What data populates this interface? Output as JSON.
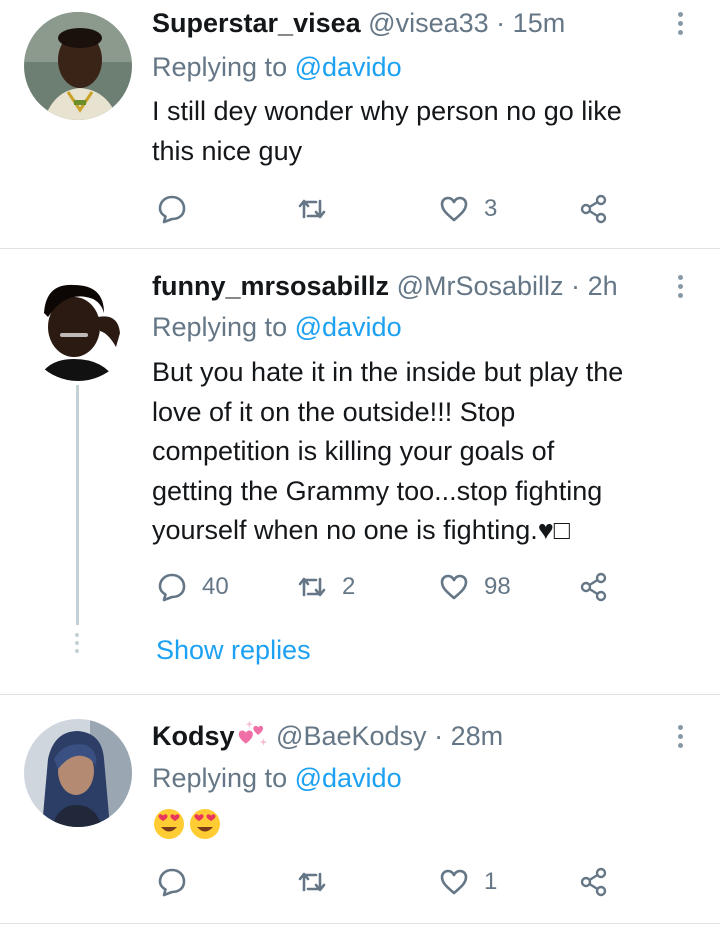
{
  "tweets": [
    {
      "name": "Superstar_visea",
      "handle": "@visea33",
      "separator": "·",
      "time": "15m",
      "replying_prefix": "Replying to",
      "replying_to": "@davido",
      "text_lines": [
        "I still dey wonder why person no go like",
        "this nice guy"
      ],
      "replies": "",
      "retweets": "",
      "likes": "3"
    },
    {
      "name": "funny_mrsosabillz",
      "handle": "@MrSosabillz",
      "separator": "·",
      "time": "2h",
      "replying_prefix": "Replying to",
      "replying_to": "@davido",
      "text_lines": [
        "But you hate it in the inside but play the",
        "love of it on the outside!!! Stop",
        "competition is killing your goals of",
        "getting the Grammy too...stop fighting",
        "yourself when no one is fighting.♥□"
      ],
      "replies": "40",
      "retweets": "2",
      "likes": "98",
      "show_replies": "Show replies"
    },
    {
      "name": "Kodsy",
      "name_emoji": "sparkling-hearts",
      "handle": "@BaeKodsy",
      "separator": "·",
      "time": "28m",
      "replying_prefix": "Replying to",
      "replying_to": "@davido",
      "text_emojis": [
        "heart-eyes-emoji",
        "heart-eyes-emoji"
      ],
      "replies": "",
      "retweets": "",
      "likes": "1"
    }
  ],
  "colors": {
    "link": "#1da1f2",
    "muted": "#657786",
    "text": "#14171a",
    "divider": "#dfe3e6"
  }
}
